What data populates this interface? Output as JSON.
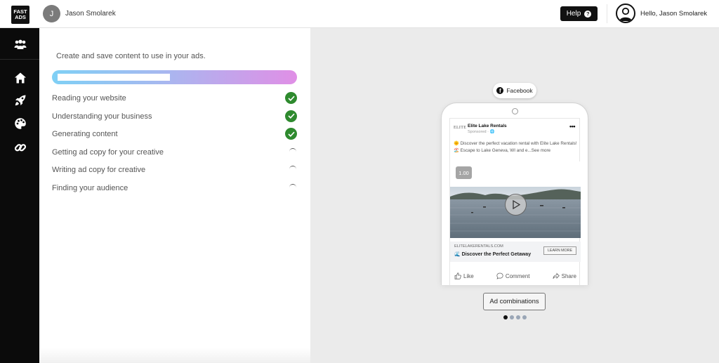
{
  "header": {
    "logo_line1": "FAST",
    "logo_line2": "ADS",
    "user_initial": "J",
    "user_name": "Jason Smolarek",
    "help_label": "Help",
    "help_icon_glyph": "?",
    "greeting": "Hello, Jason Smolarek"
  },
  "sidebar": {
    "items": [
      {
        "name": "team-icon"
      },
      {
        "name": "home-icon"
      },
      {
        "name": "rocket-icon"
      },
      {
        "name": "palette-icon"
      },
      {
        "name": "link-icon"
      }
    ]
  },
  "progress_panel": {
    "intro": "Create and save content to use in your ads.",
    "progress_fraction": 0.48,
    "gradient_colors": [
      "#7fd0f5",
      "#a7b8f0",
      "#e08fe6"
    ],
    "steps": [
      {
        "label": "Reading your website",
        "status": "done"
      },
      {
        "label": "Understanding your business",
        "status": "done"
      },
      {
        "label": "Generating content",
        "status": "done"
      },
      {
        "label": "Getting ad copy for your creative",
        "status": "loading"
      },
      {
        "label": "Writing ad copy for creative",
        "status": "loading"
      },
      {
        "label": "Finding your audience",
        "status": "loading"
      }
    ],
    "done_color": "#2e8a2e"
  },
  "preview": {
    "platform": "Facebook",
    "post": {
      "logo_text": "ELITE",
      "page_name": "Elite Lake Rentals",
      "sponsored": "Sponsored · 🌐",
      "more_glyph": "•••",
      "body": "🌞 Discover the perfect vacation rental with Elite Lake Rentals! 🏖️ Escape to Lake Geneva, WI and e...See more",
      "video_time": "1.00",
      "link_domain": "ELITELAKERENTALS.COM",
      "link_title": "🌊 Discover the Perfect Getaway",
      "cta": "LEARN MORE",
      "actions": {
        "like": "Like",
        "comment": "Comment",
        "share": "Share"
      }
    },
    "combinations_label": "Ad combinations",
    "pagination": {
      "total": 4,
      "active_index": 0
    }
  }
}
